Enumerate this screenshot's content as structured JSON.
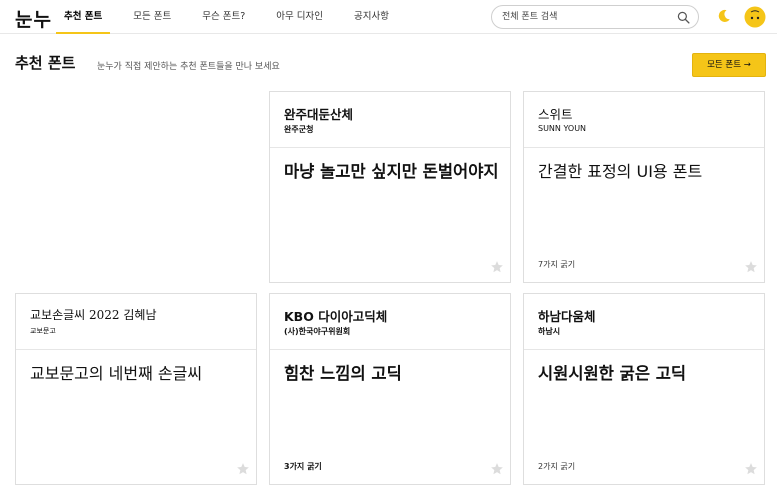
{
  "app": {
    "logo": "눈누"
  },
  "nav": {
    "items": [
      {
        "label": "추천 폰트",
        "active": true
      },
      {
        "label": "모든 폰트",
        "active": false
      },
      {
        "label": "무슨 폰트?",
        "active": false
      },
      {
        "label": "아무 디자인",
        "active": false
      },
      {
        "label": "공지사항",
        "active": false
      }
    ]
  },
  "search": {
    "placeholder": "전체 폰트 검색",
    "value": ""
  },
  "icons": {
    "search": "search-icon",
    "moon": "moon-icon",
    "avatar": "smiley-avatar",
    "star": "star-icon"
  },
  "colors": {
    "accent": "#f5c518",
    "star": "#dcdcdc",
    "border": "#dedede"
  },
  "header": {
    "title": "추천 폰트",
    "subtitle": "눈누가 직접 제안하는 추천 폰트들을 만나 보세요",
    "all_fonts_button": "모든 폰트 →"
  },
  "cards": [
    {
      "name": "완주대둔산체",
      "author": "완주군청",
      "sample": "마냥 놀고만 싶지만 돈벌어야지",
      "weights": ""
    },
    {
      "name": "스위트",
      "author": "SUNN YOUN",
      "sample": "간결한 표정의 UI용 폰트",
      "weights": "7가지 굵기"
    },
    {
      "name": "교보손글씨 2022 김혜남",
      "author": "교보문고",
      "sample": "교보문고의 네번째 손글씨",
      "weights": ""
    },
    {
      "name": "KBO 다이아고딕체",
      "author": "(사)한국야구위원회",
      "sample": "힘찬 느낌의 고딕",
      "weights": "3가지 굵기"
    },
    {
      "name": "하남다움체",
      "author": "하남시",
      "sample": "시원시원한 굵은 고딕",
      "weights": "2가지 굵기"
    }
  ]
}
